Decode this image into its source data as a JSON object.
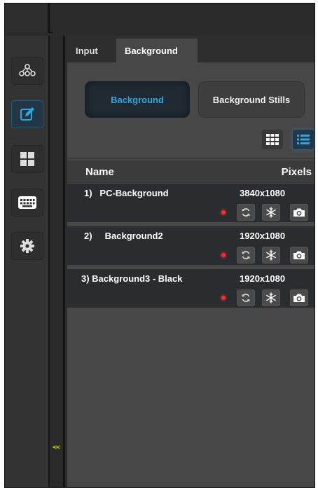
{
  "tabs": [
    {
      "label": "Input"
    },
    {
      "label": "Background"
    }
  ],
  "modes": {
    "background": "Background",
    "stills": "Background Stills"
  },
  "view": {
    "selected": "list"
  },
  "list": {
    "headers": {
      "name": "Name",
      "pixels": "Pixels"
    },
    "rows": [
      {
        "name": "1)   PC-Background",
        "pixels": "3840x1080",
        "status": "red"
      },
      {
        "name": "2)     Background2",
        "pixels": "1920x1080",
        "status": "red"
      },
      {
        "name": "3) Background3 - Black",
        "pixels": "1920x1080",
        "status": "red"
      }
    ]
  },
  "sidebar": {
    "items": [
      {
        "icon": "network-icon",
        "active": false
      },
      {
        "icon": "edit-icon",
        "active": true
      },
      {
        "icon": "layout-grid-icon",
        "active": false
      },
      {
        "icon": "keyboard-icon",
        "active": false
      },
      {
        "icon": "gear-icon",
        "active": false
      }
    ]
  },
  "collapse": {
    "label": "<<"
  },
  "colors": {
    "accent": "#2fa6e0",
    "status_red": "#ff2a2a",
    "collapse_yellow": "#d7d000"
  }
}
